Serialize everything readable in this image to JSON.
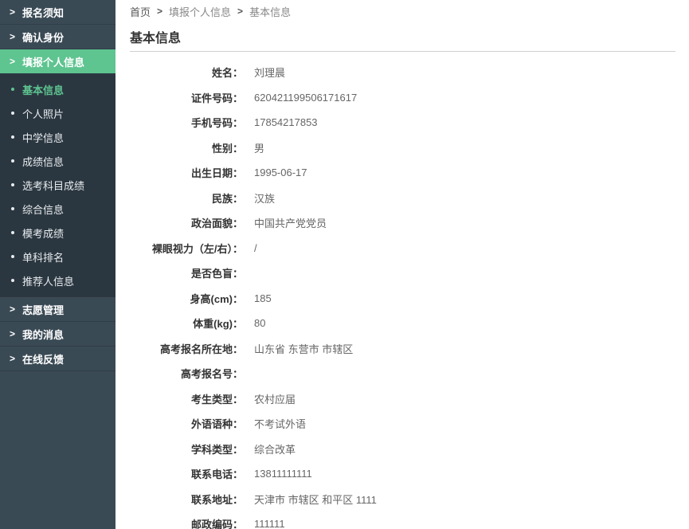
{
  "sidebar": {
    "top_items": [
      "报名须知",
      "确认身份",
      "填报个人信息"
    ],
    "sub_items": [
      "基本信息",
      "个人照片",
      "中学信息",
      "成绩信息",
      "选考科目成绩",
      "综合信息",
      "模考成绩",
      "单科排名",
      "推荐人信息"
    ],
    "bottom_items": [
      "志愿管理",
      "我的消息",
      "在线反馈"
    ]
  },
  "breadcrumb": {
    "home": "首页",
    "section": "填报个人信息",
    "current": "基本信息"
  },
  "page_title": "基本信息",
  "fields": [
    {
      "label": "姓名：",
      "value": "刘理晨"
    },
    {
      "label": "证件号码：",
      "value": "620421199506171617"
    },
    {
      "label": "手机号码：",
      "value": "17854217853"
    },
    {
      "label": "性别：",
      "value": "男"
    },
    {
      "label": "出生日期：",
      "value": "1995-06-17"
    },
    {
      "label": "民族：",
      "value": "汉族"
    },
    {
      "label": "政治面貌：",
      "value": "中国共产党党员"
    },
    {
      "label": "裸眼视力（左/右）：",
      "value": "/"
    },
    {
      "label": "是否色盲：",
      "value": ""
    },
    {
      "label": "身高(cm)：",
      "value": "185"
    },
    {
      "label": "体重(kg)：",
      "value": "80"
    },
    {
      "label": "高考报名所在地：",
      "value": "山东省 东营市 市辖区"
    },
    {
      "label": "高考报名号：",
      "value": ""
    },
    {
      "label": "考生类型：",
      "value": "农村应届"
    },
    {
      "label": "外语语种：",
      "value": "不考试外语"
    },
    {
      "label": "学科类型：",
      "value": "综合改革"
    },
    {
      "label": "联系电话：",
      "value": "13811111111"
    },
    {
      "label": "联系地址：",
      "value": "天津市 市辖区 和平区 1111"
    },
    {
      "label": "邮政编码：",
      "value": "111111"
    }
  ]
}
